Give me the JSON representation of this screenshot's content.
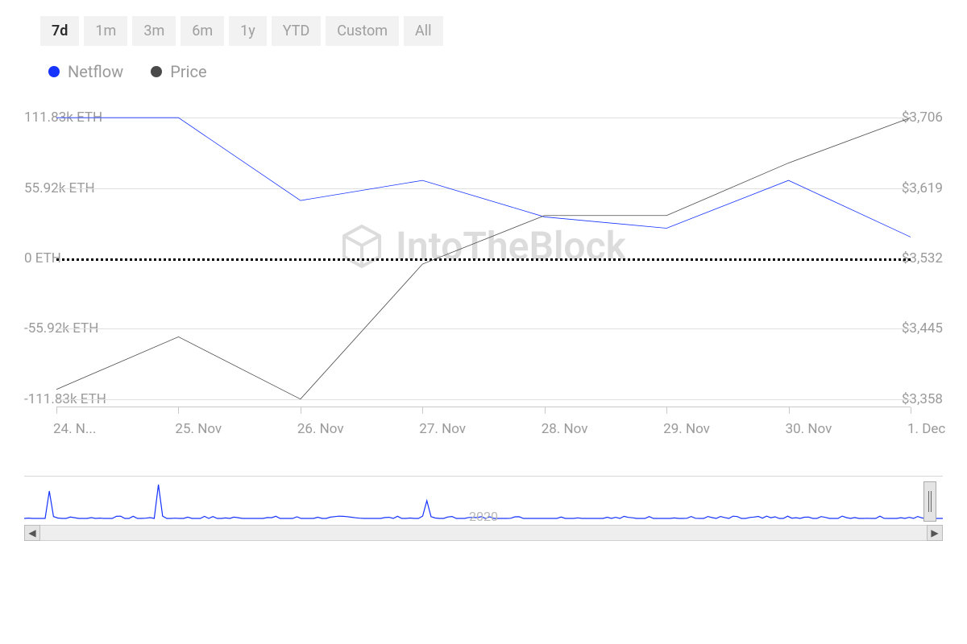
{
  "range_tabs": [
    "7d",
    "1m",
    "3m",
    "6m",
    "1y",
    "YTD",
    "Custom",
    "All"
  ],
  "active_tab": "7d",
  "legend": {
    "netflow": {
      "label": "Netflow",
      "color": "#1733ff"
    },
    "price": {
      "label": "Price",
      "color": "#4a4a4a"
    }
  },
  "watermark": "IntoTheBlock",
  "navigator_year": "2020",
  "y_left_ticks": [
    "111.83k ETH",
    "55.92k ETH",
    "0 ETH",
    "-55.92k ETH",
    "-111.83k ETH"
  ],
  "y_right_ticks": [
    "$3,706",
    "$3,619",
    "$3,532",
    "$3,445",
    "$3,358"
  ],
  "x_ticks": [
    "24. N...",
    "25. Nov",
    "26. Nov",
    "27. Nov",
    "28. Nov",
    "29. Nov",
    "30. Nov",
    "1. Dec"
  ],
  "chart_data": {
    "type": "line",
    "x": [
      "24. Nov",
      "25. Nov",
      "26. Nov",
      "27. Nov",
      "28. Nov",
      "29. Nov",
      "30. Nov",
      "1. Dec"
    ],
    "series": [
      {
        "name": "Netflow",
        "unit": "ETH",
        "color": "#1733ff",
        "values": [
          111830,
          111830,
          46000,
          62000,
          33000,
          24000,
          62000,
          17000
        ],
        "ylim": [
          -111830,
          111830
        ],
        "y_ticks": [
          111830,
          55920,
          0,
          -55920,
          -111830
        ],
        "axis": "left"
      },
      {
        "name": "Price",
        "unit": "USD",
        "color": "#4a4a4a",
        "values": [
          3370,
          3435,
          3358,
          3525,
          3585,
          3585,
          3650,
          3706
        ],
        "ylim": [
          3358,
          3706
        ],
        "y_ticks": [
          3706,
          3619,
          3532,
          3445,
          3358
        ],
        "axis": "right"
      }
    ],
    "zero_line_axis": "left",
    "zero_line_value": 0,
    "grid": true
  }
}
